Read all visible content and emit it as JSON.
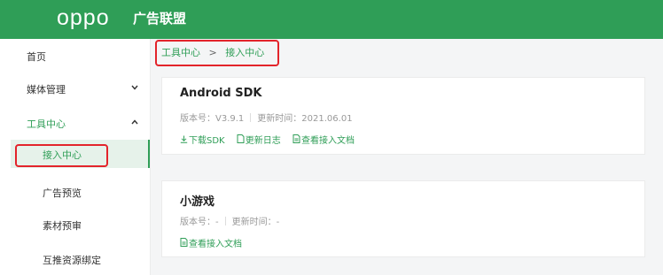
{
  "header": {
    "logo_text": "oppo",
    "brand_title": "广告联盟"
  },
  "sidebar": {
    "items": [
      {
        "label": "首页"
      },
      {
        "label": "媒体管理",
        "chevron": "chevron-down-icon"
      },
      {
        "label": "工具中心",
        "chevron": "chevron-up-icon",
        "expanded": true
      },
      {
        "label": "接入中心",
        "active": true
      },
      {
        "label": "广告预览"
      },
      {
        "label": "素材预审"
      },
      {
        "label": "互推资源绑定"
      }
    ]
  },
  "breadcrumb": {
    "root": "工具中心",
    "separator": ">",
    "current": "接入中心"
  },
  "cards": [
    {
      "title": "Android SDK",
      "version_label": "版本号：",
      "version": "V3.9.1",
      "updated_label": "更新时间：",
      "updated": "2021.06.01",
      "links": [
        {
          "icon": "download-icon",
          "label": "下载SDK"
        },
        {
          "icon": "document-icon",
          "label": "更新日志"
        },
        {
          "icon": "document-icon",
          "label": "查看接入文档"
        }
      ]
    },
    {
      "title": "小游戏",
      "version_label": "版本号：",
      "version": "-",
      "updated_label": "更新时间：",
      "updated": "-",
      "links": [
        {
          "icon": "document-icon",
          "label": "查看接入文档"
        }
      ]
    }
  ],
  "colors": {
    "brand_green": "#2f9e57",
    "highlight_red": "#e3242b",
    "active_bg": "#e6f2ea"
  }
}
